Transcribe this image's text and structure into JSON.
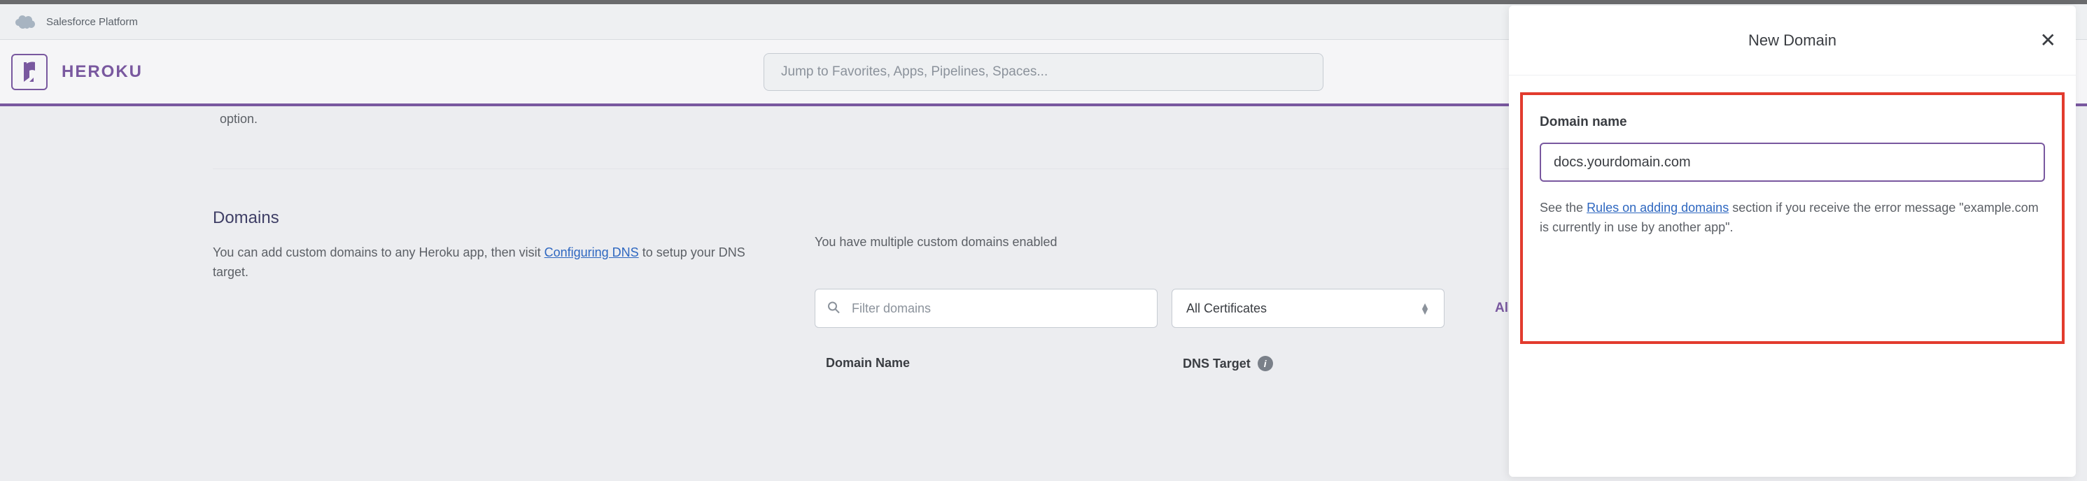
{
  "platform_bar": {
    "label": "Salesforce Platform"
  },
  "header": {
    "brand": "HEROKU",
    "search_placeholder": "Jump to Favorites, Apps, Pipelines, Spaces..."
  },
  "page": {
    "trailing_text": "option.",
    "domains": {
      "title": "Domains",
      "desc_pre": "You can add custom domains to any Heroku app, then visit ",
      "desc_link": "Configuring DNS",
      "desc_post": " to setup your DNS target.",
      "status": "You have multiple custom domains enabled",
      "filter_placeholder": "Filter domains",
      "cert_selected": "All Certificates",
      "all_domains_label": "All Domains",
      "table": {
        "col_domain": "Domain Name",
        "col_dns": "DNS Target"
      }
    }
  },
  "panel": {
    "title": "New Domain",
    "field_label": "Domain name",
    "input_value": "docs.yourdomain.com",
    "help_pre": "See the ",
    "help_link": "Rules on adding domains",
    "help_post": " section if you receive the error message \"example.com is currently in use by another app\"."
  }
}
